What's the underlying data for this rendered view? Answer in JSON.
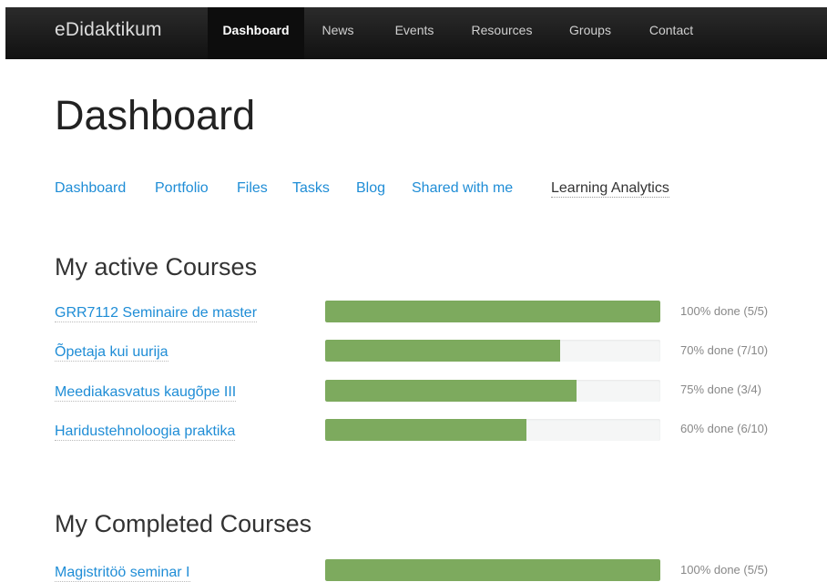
{
  "navbar": {
    "brand": "eDidaktikum",
    "items": [
      {
        "label": "Dashboard",
        "active": true
      },
      {
        "label": "News",
        "active": false
      },
      {
        "label": "Events",
        "active": false
      },
      {
        "label": "Resources",
        "active": false
      },
      {
        "label": "Groups",
        "active": false
      },
      {
        "label": "Contact",
        "active": false
      }
    ]
  },
  "page": {
    "title": "Dashboard"
  },
  "subnav": {
    "items": [
      {
        "label": "Dashboard"
      },
      {
        "label": "Portfolio"
      },
      {
        "label": "Files"
      },
      {
        "label": "Tasks"
      },
      {
        "label": "Blog"
      },
      {
        "label": "Shared with me"
      },
      {
        "label": "Learning Analytics",
        "current": true
      }
    ]
  },
  "active_courses": {
    "title": "My active Courses",
    "courses": [
      {
        "name": "GRR7112 Seminaire de master",
        "progress": 1.0,
        "progress_text": "100% done (5/5)"
      },
      {
        "name": "Õpetaja kui uurija",
        "progress": 0.7,
        "progress_text": "70% done (7/10)"
      },
      {
        "name": "Meediakasvatus kaugõpe III",
        "progress": 0.75,
        "progress_text": "75% done (3/4)"
      },
      {
        "name": "Haridustehnoloogia praktika",
        "progress": 0.6,
        "progress_text": "60% done (6/10)"
      }
    ]
  },
  "completed_courses": {
    "title": "My Completed Courses",
    "courses": [
      {
        "name": "Magistritöö seminar I",
        "progress": 1.0,
        "progress_text": "100% done (5/5)"
      }
    ]
  },
  "colors": {
    "navbar_bg": "#1a1a1a",
    "link": "#1f8dd6",
    "progress_fill": "#7daa5e",
    "progress_track": "#f5f6f6"
  }
}
